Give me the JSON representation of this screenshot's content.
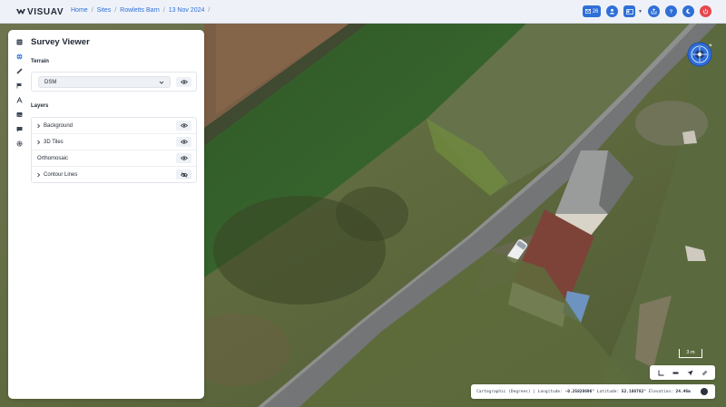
{
  "app": {
    "logo_text": "VISUAV"
  },
  "breadcrumb": [
    "Home",
    "Sites",
    "Rowletts Barn",
    "13 Nov 2024"
  ],
  "header": {
    "message_count": "26",
    "icons": [
      "mail-icon",
      "user-icon",
      "id-card-icon",
      "share-icon",
      "help-icon",
      "moon-icon",
      "power-icon"
    ]
  },
  "sidebar": {
    "icons": [
      "layers-icon",
      "globe-icon",
      "ruler-icon",
      "flag-icon",
      "triangle-a-icon",
      "image-icon",
      "chat-icon",
      "gear-icon"
    ]
  },
  "panel": {
    "title": "Survey Viewer",
    "terrain_label": "Terrain",
    "terrain_value": "DSM",
    "layers_label": "Layers",
    "layers": [
      {
        "label": "Background",
        "expandable": true,
        "visible": true
      },
      {
        "label": "3D Tiles",
        "expandable": true,
        "visible": true
      },
      {
        "label": "Orthomosaic",
        "expandable": false,
        "visible": true
      },
      {
        "label": "Contour Lines",
        "expandable": true,
        "visible": false
      }
    ]
  },
  "map": {
    "scale_label": "3 m",
    "coords": {
      "prefix": "Cartographic (Degrees) | Longitude:",
      "longitude": "-0.25828696°",
      "lat_label": "Latitude:",
      "latitude": "52.188782°",
      "elev_label": "Elevation:",
      "elevation": "24.46m"
    }
  },
  "colors": {
    "accent": "#2f6fd8",
    "danger": "#e5484d"
  }
}
